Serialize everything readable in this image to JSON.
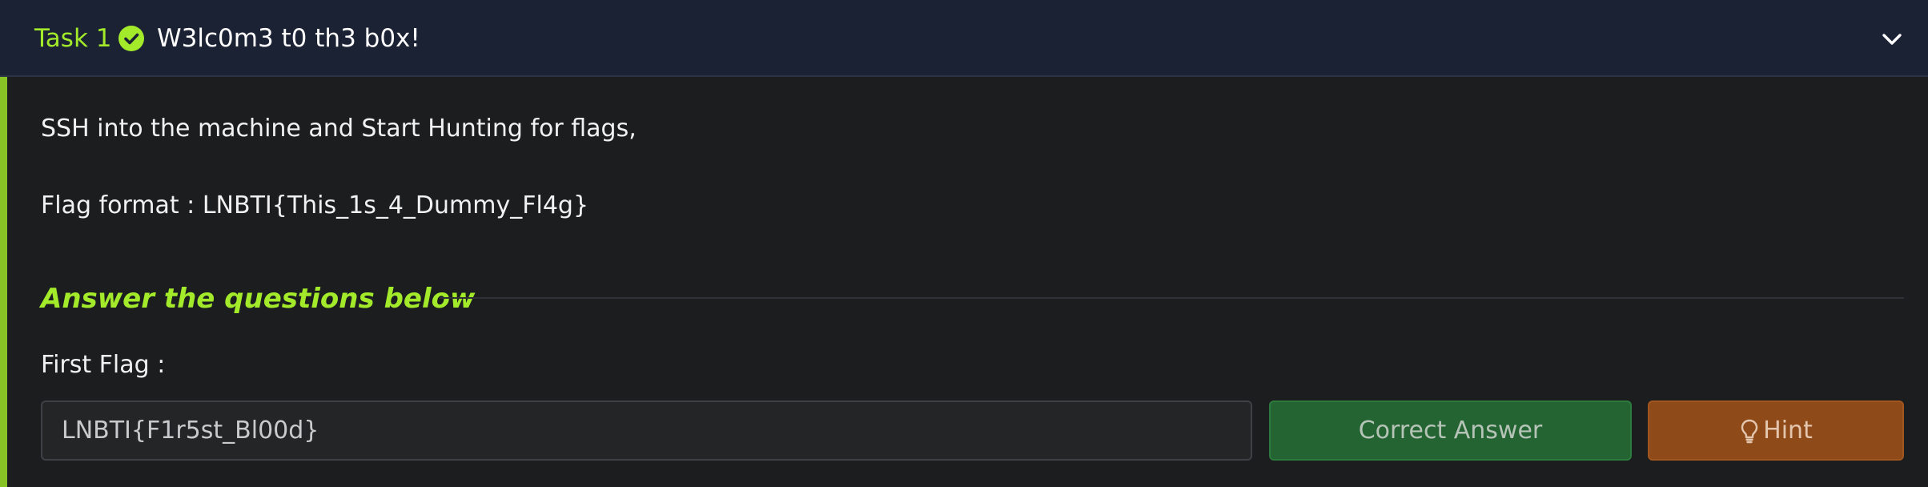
{
  "task": {
    "number_label": "Task 1",
    "title": "W3lc0m3 t0 th3 b0x!",
    "completed_icon": "check-circle-icon",
    "toggle_icon": "chevron-down-icon"
  },
  "content": {
    "intro_line": "SSH into the machine and Start Hunting for flags,",
    "flag_format_line": "Flag format : LNBTI{This_1s_4_Dummy_Fl4g}"
  },
  "questions": {
    "heading": "Answer the questions below",
    "items": [
      {
        "label": "First Flag :",
        "answer_value": "LNBTI{F1r5st_Bl00d}",
        "status_button_label": "Correct Answer",
        "hint_button_label": "Hint",
        "hint_icon": "lightbulb-icon"
      }
    ]
  },
  "colors": {
    "accent": "#a3ea2a",
    "header_bg": "#1b2234",
    "panel_bg": "#1c1d1f",
    "correct_button_bg": "#246433",
    "hint_button_bg": "#8f4a1a"
  }
}
